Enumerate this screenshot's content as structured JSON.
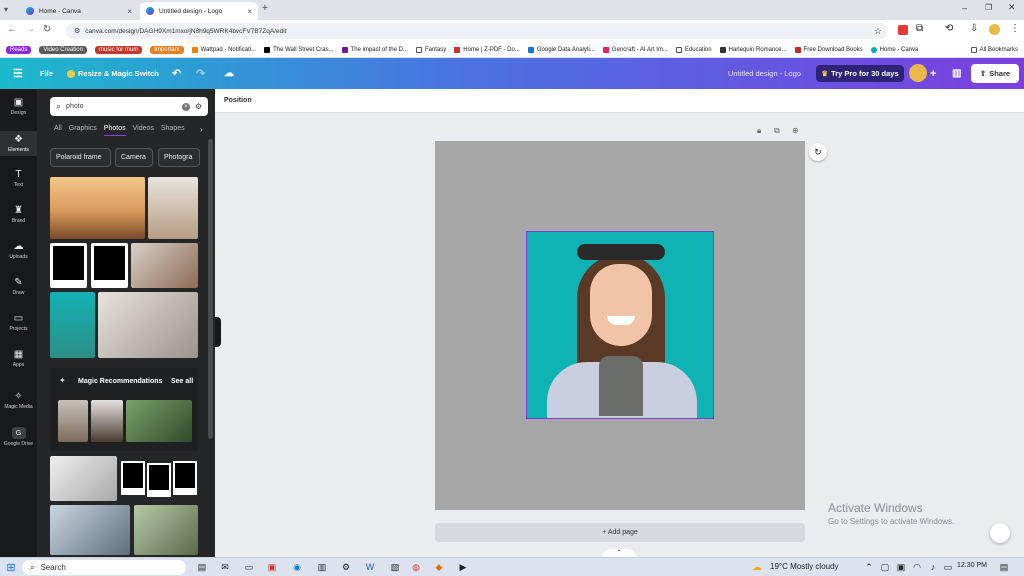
{
  "browser": {
    "tabs": [
      {
        "title": "Home - Canva",
        "active": false
      },
      {
        "title": "Untitled design - Logo",
        "active": true
      }
    ],
    "url": "canva.com/design/DAGH9Xm1mxo/jN8h9q5WRK4bvcFV7B7ZqA/edit",
    "bookmarks": [
      "Reads",
      "Video Creation",
      "music for mum",
      "Important",
      "Wattpad - Notificati...",
      "The Wall Street Cras...",
      "The impact of the D...",
      "Fantasy",
      "Home | Z-PDF - Do...",
      "Google Data Analyti...",
      "Gencraft - AI Art Im...",
      "Education",
      "Harlequin Romance...",
      "Free Download Books",
      "Home - Canva"
    ],
    "all_bookmarks": "All Bookmarks"
  },
  "header": {
    "file": "File",
    "resize": "Resize & Magic Switch",
    "design_title": "Untitled design - Logo",
    "try_pro": "Try Pro for 30 days",
    "share": "Share"
  },
  "rail": [
    "Design",
    "Elements",
    "Text",
    "Brand",
    "Uploads",
    "Draw",
    "Projects",
    "Apps",
    "Magic Media",
    "Google Drive"
  ],
  "panel": {
    "search_value": "photo",
    "categories": [
      "All",
      "Graphics",
      "Photos",
      "Videos",
      "Shapes"
    ],
    "pills": [
      "Polaroid frame",
      "Camera",
      "Photogra"
    ],
    "magic_title": "Magic Recommendations",
    "see_all": "See all"
  },
  "workspace": {
    "position_label": "Position",
    "add_page": "+ Add page",
    "activate_title": "Activate Windows",
    "activate_sub": "Go to Settings to activate Windows."
  },
  "taskbar": {
    "search": "Search",
    "weather": "19°C  Mostly cloudy",
    "time": "12:30 PM"
  }
}
